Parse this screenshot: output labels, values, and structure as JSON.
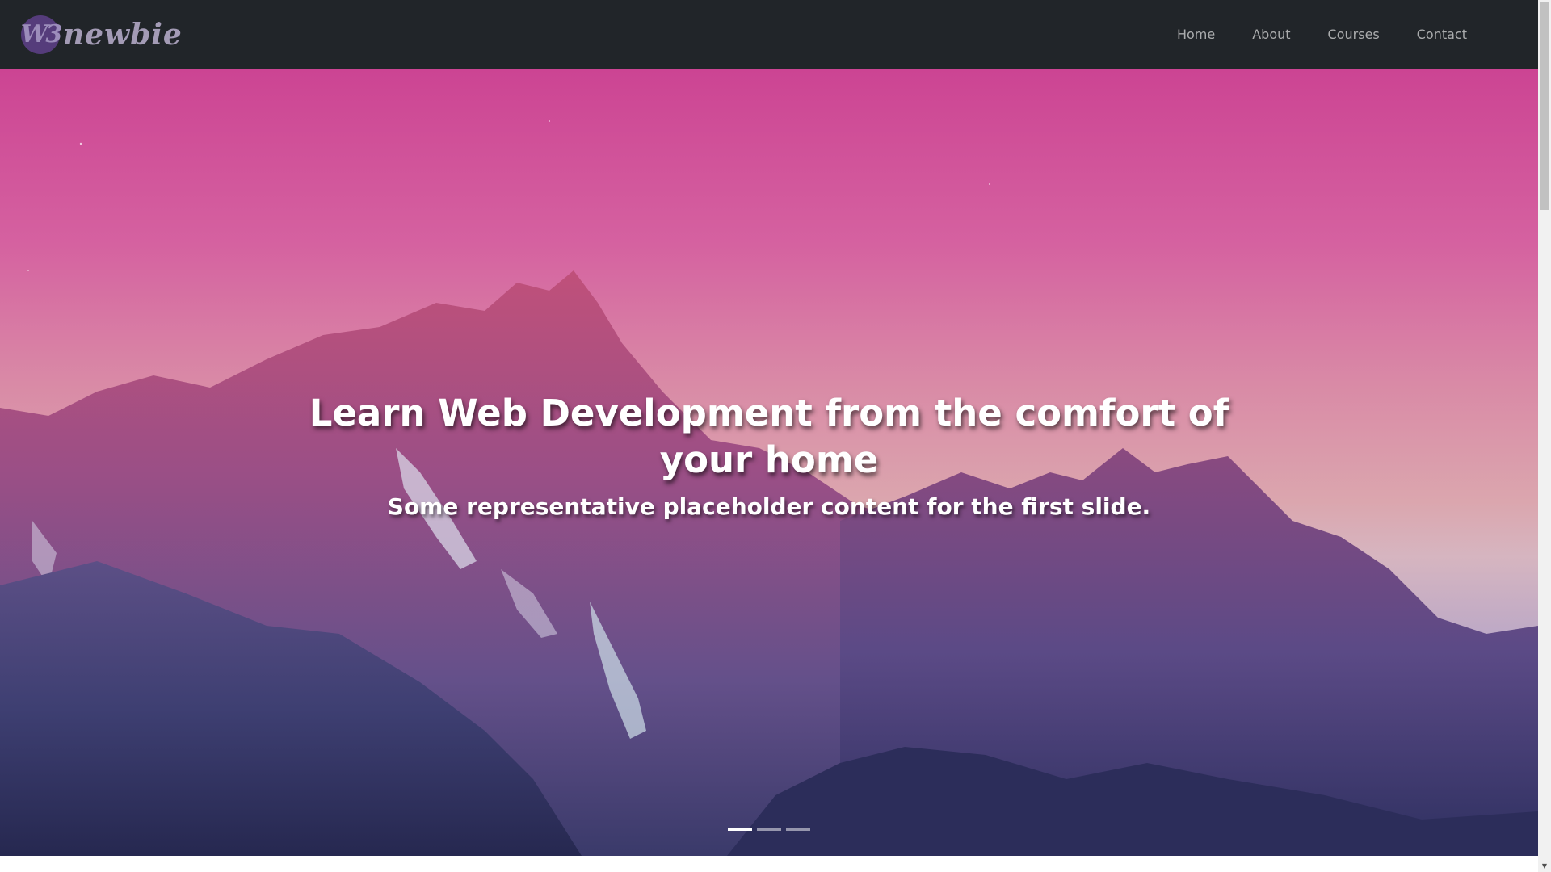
{
  "navbar": {
    "brand_badge": "W3",
    "brand_text": "newbie",
    "links": [
      "Home",
      "About",
      "Courses",
      "Contact"
    ]
  },
  "hero": {
    "title": "Learn Web Development from the comfort of your home",
    "subtitle": "Some representative placeholder content for the first slide.",
    "slide_count": 3,
    "active_slide": 1
  },
  "colors": {
    "navbar_bg": "#212529",
    "sky_top": "#cc4493",
    "mountain_shadow": "#2e2f5c"
  },
  "icons": {
    "scroll_down": "▼"
  }
}
